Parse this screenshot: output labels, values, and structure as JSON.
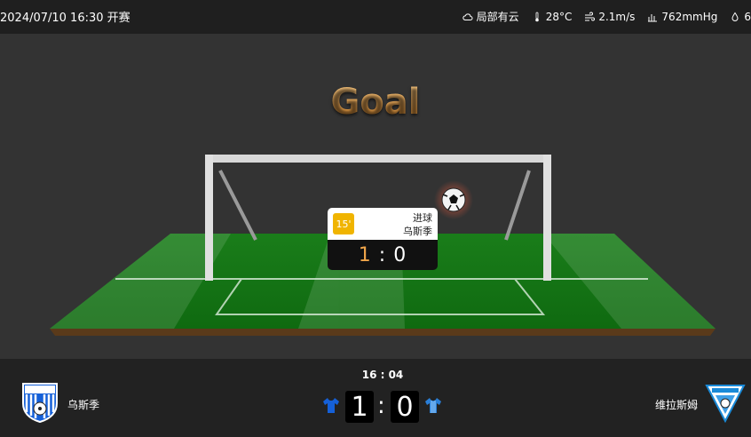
{
  "header": {
    "date_status": "2024/07/10 16:30 开赛",
    "weather": {
      "condition": "局部有云",
      "temperature": "28°C",
      "wind": "2.1m/s",
      "pressure": "762mmHg",
      "humidity_partial": "6"
    }
  },
  "animation": {
    "title": "Goal",
    "event": {
      "minute": "15'",
      "type": "进球",
      "team": "乌斯季",
      "score_home": "1",
      "score_sep": ":",
      "score_away": "0"
    }
  },
  "match": {
    "clock": "16 : 04",
    "home": {
      "name": "乌斯季",
      "score": "1",
      "jersey_color": "#1560d8"
    },
    "away": {
      "name": "维拉斯姆",
      "score": "0",
      "jersey_color": "#2a7fd8"
    },
    "separator": ":"
  },
  "colors": {
    "pitch": "#1a8a1a",
    "accent": "#f0a54a",
    "minute_badge": "#f0b400"
  }
}
